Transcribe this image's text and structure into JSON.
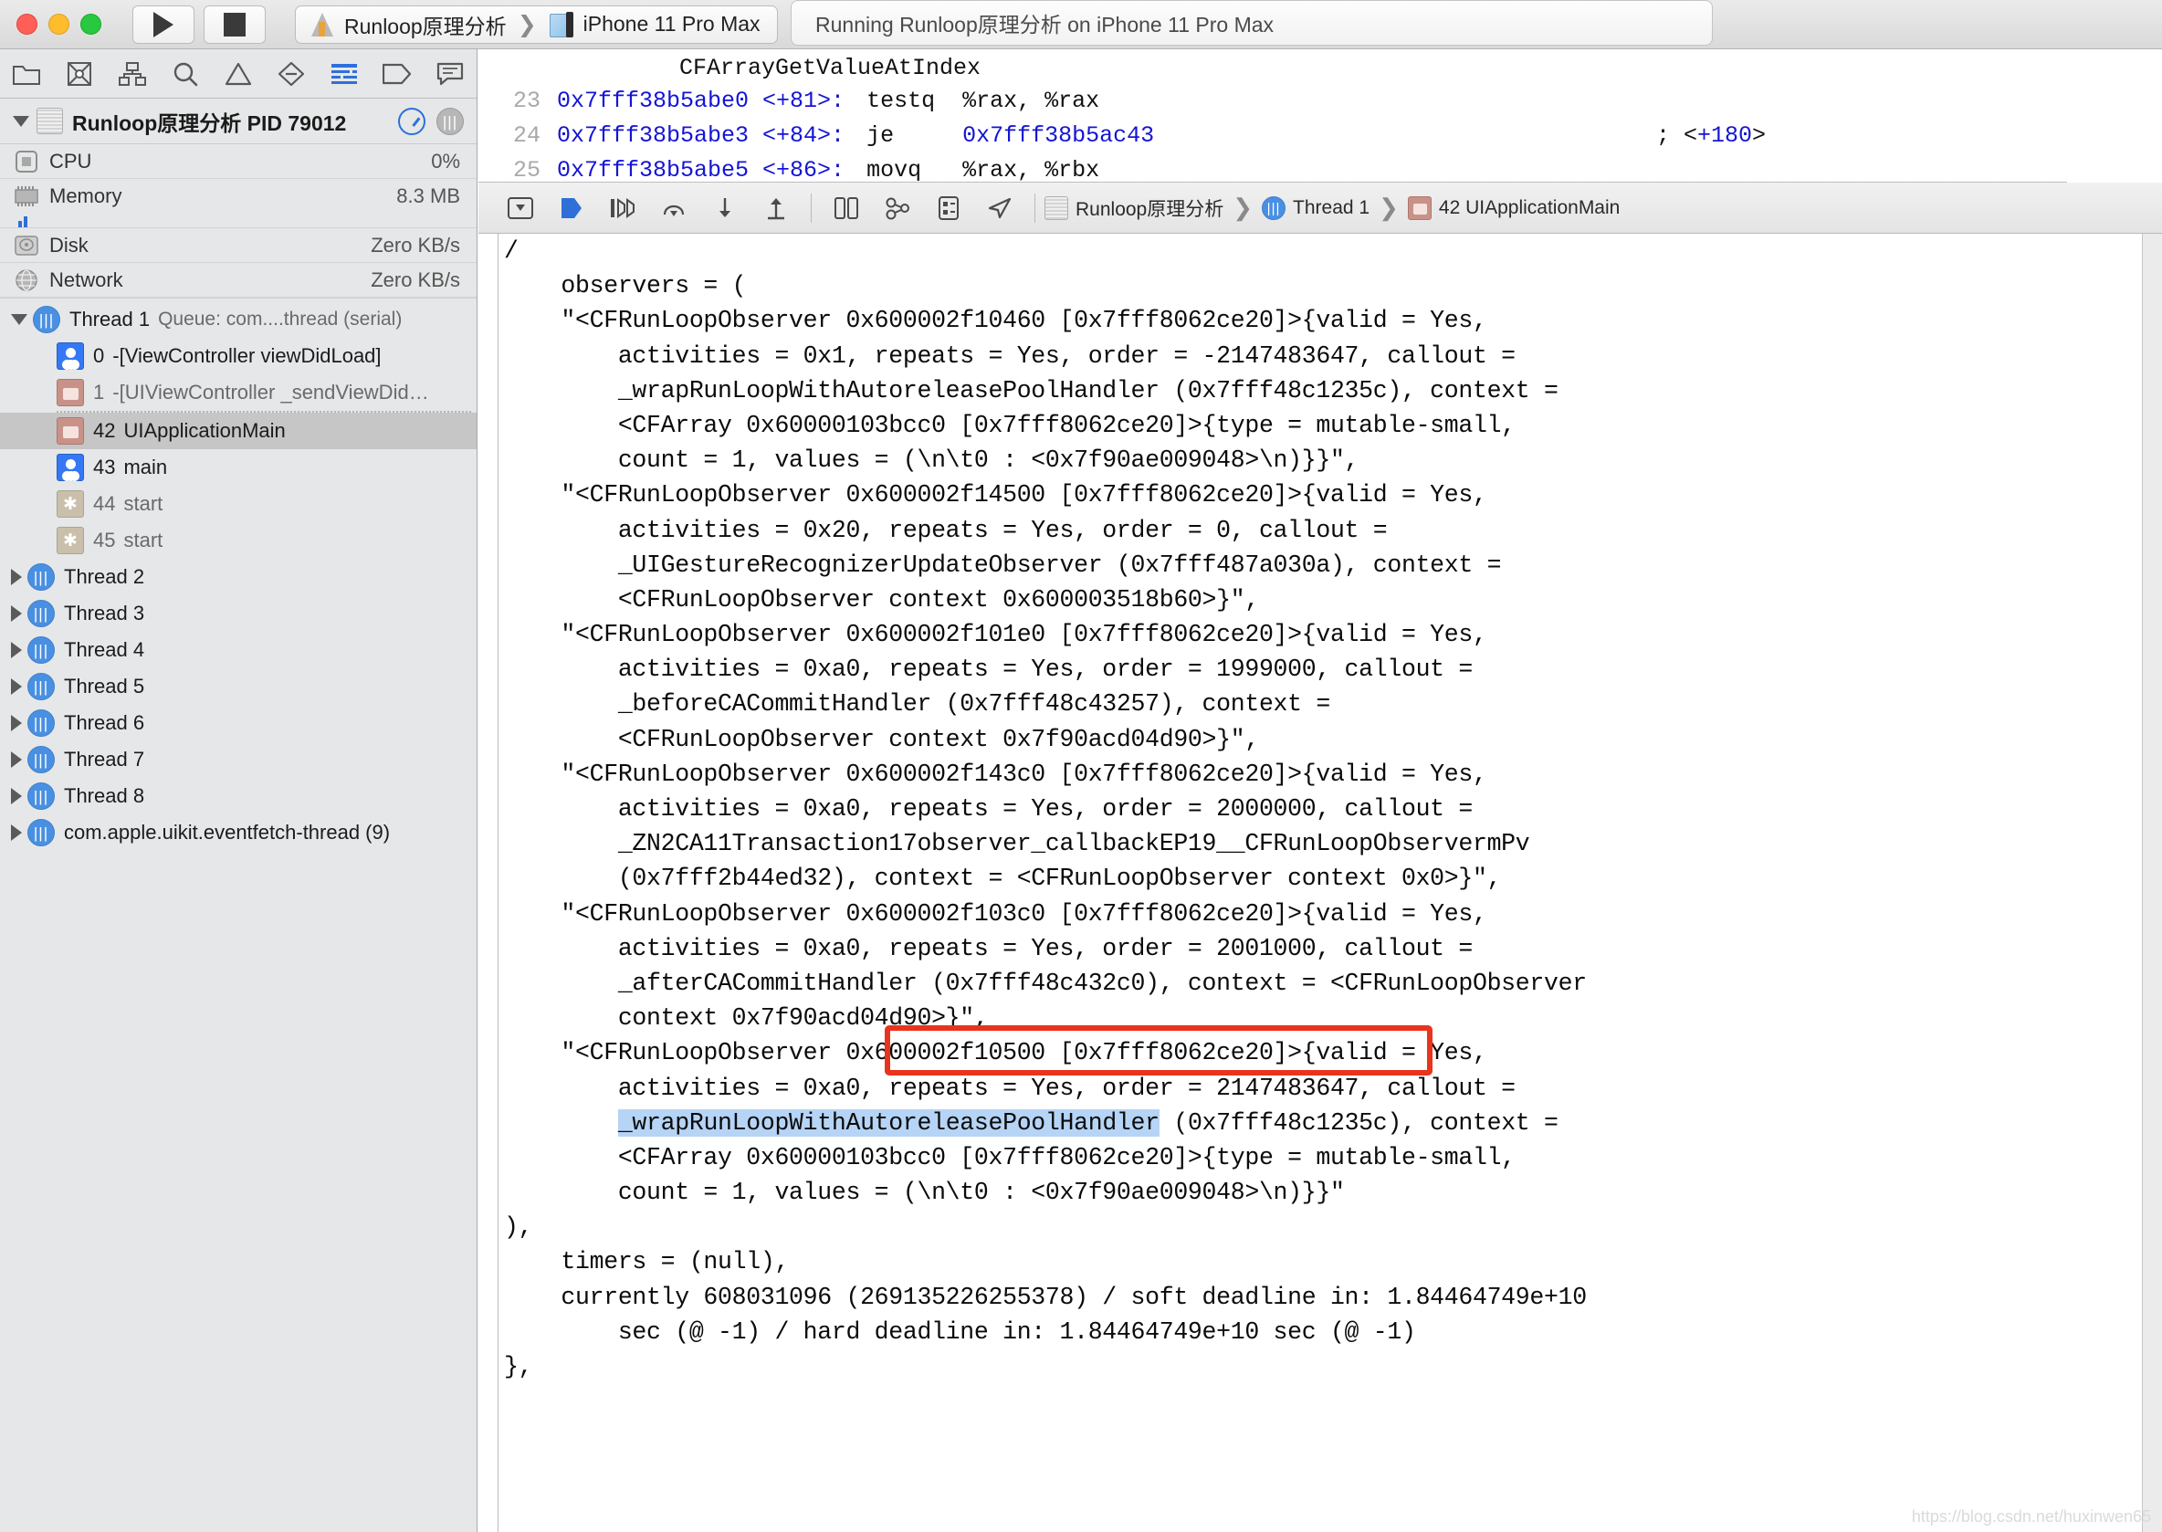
{
  "titlebar": {
    "run_button": "run-play",
    "stop_button": "stop",
    "scheme_name": "Runloop原理分析",
    "destination_name": "iPhone 11 Pro Max",
    "scheme_separator": "❯",
    "status_text": "Running Runloop原理分析 on iPhone 11 Pro Max"
  },
  "navigator": {
    "toolbar_icons": [
      "folder-icon",
      "source-control-icon",
      "symbol-icon",
      "search-icon",
      "warning-icon",
      "breakpoint-icon",
      "debug-report-icon",
      "tag-icon",
      "comment-icon"
    ],
    "header": {
      "title": "Runloop原理分析 PID 79012",
      "gauge_icon": "gauge-icon",
      "thread_icon": "threads-icon"
    },
    "gauges": [
      {
        "icon": "cpu-icon",
        "label": "CPU",
        "value": "0%"
      },
      {
        "icon": "memory-icon",
        "label": "Memory",
        "value": "8.3 MB"
      },
      {
        "icon": "disk-icon",
        "label": "Disk",
        "value": "Zero KB/s"
      },
      {
        "icon": "network-icon",
        "label": "Network",
        "value": "Zero KB/s"
      }
    ],
    "threads": [
      {
        "type": "thread",
        "expanded": true,
        "selected": false,
        "label": "Thread 1",
        "sublabel": "Queue: com....thread (serial)",
        "frames": [
          {
            "index": "0",
            "label": "-[ViewController viewDidLoad]",
            "icon": "user-frame-icon",
            "dim": false,
            "selected": false
          },
          {
            "index": "1",
            "label": "-[UIViewController _sendViewDid…",
            "icon": "system-frame-icon",
            "dim": true,
            "selected": false
          },
          {
            "index": "42",
            "label": "UIApplicationMain",
            "icon": "system-frame-icon",
            "dim": false,
            "selected": true
          },
          {
            "index": "43",
            "label": "main",
            "icon": "user-frame-icon",
            "dim": false,
            "selected": false
          },
          {
            "index": "44",
            "label": "start",
            "icon": "gear-frame-icon",
            "dim": true,
            "selected": false
          },
          {
            "index": "45",
            "label": "start",
            "icon": "gear-frame-icon",
            "dim": true,
            "selected": false
          }
        ]
      },
      {
        "type": "thread",
        "expanded": false,
        "selected": false,
        "label": "Thread 2",
        "sublabel": "",
        "frames": []
      },
      {
        "type": "thread",
        "expanded": false,
        "selected": false,
        "label": "Thread 3",
        "sublabel": "",
        "frames": []
      },
      {
        "type": "thread",
        "expanded": false,
        "selected": false,
        "label": "Thread 4",
        "sublabel": "",
        "frames": []
      },
      {
        "type": "thread",
        "expanded": false,
        "selected": false,
        "label": "Thread 5",
        "sublabel": "",
        "frames": []
      },
      {
        "type": "thread",
        "expanded": false,
        "selected": false,
        "label": "Thread 6",
        "sublabel": "",
        "frames": []
      },
      {
        "type": "thread",
        "expanded": false,
        "selected": false,
        "label": "Thread 7",
        "sublabel": "",
        "frames": []
      },
      {
        "type": "thread",
        "expanded": false,
        "selected": false,
        "label": "Thread 8",
        "sublabel": "",
        "frames": []
      },
      {
        "type": "thread",
        "expanded": false,
        "selected": false,
        "label": "com.apple.uikit.eventfetch-thread (9)",
        "sublabel": "",
        "frames": []
      }
    ]
  },
  "disassembly": {
    "symbol": "CFArrayGetValueAtIndex",
    "lines": [
      {
        "num": "23",
        "addr": "0x7fff38b5abe0 <+81>:",
        "op": "testq  %rax, %rax",
        "target": "",
        "comment": "",
        "comment_ref": ""
      },
      {
        "num": "24",
        "addr": "0x7fff38b5abe3 <+84>:",
        "op": "je     ",
        "target": "0x7fff38b5ac43",
        "comment": "; <",
        "comment_ref": "+180"
      },
      {
        "num": "25",
        "addr": "0x7fff38b5abe5 <+86>:",
        "op": "movq   %rax, %rbx",
        "target": "",
        "comment": "",
        "comment_ref": ""
      }
    ]
  },
  "debugbar": {
    "icons": [
      "hide-debug-area-icon",
      "continue-icon",
      "step-over-icon",
      "step-into-icon",
      "step-out-icon",
      "step-out-up-icon",
      "view-hierarchy-icon",
      "memory-graph-icon",
      "environment-overrides-icon",
      "location-simulate-icon"
    ],
    "breadcrumb": [
      {
        "icon": "app-icon",
        "label": "Runloop原理分析"
      },
      {
        "icon": "thread-icon",
        "label": "Thread 1"
      },
      {
        "icon": "frame-icon",
        "label": "42 UIApplicationMain"
      }
    ],
    "separator": "❯"
  },
  "console": {
    "selection_text": "_wrapRunLoopWithAutoreleasePoolHandler",
    "annotation_color": "#e8341c",
    "selection_color": "#b6d4f5",
    "lines": [
      "/",
      "    observers = (",
      "    \"<CFRunLoopObserver 0x600002f10460 [0x7fff8062ce20]>{valid = Yes,",
      "        activities = 0x1, repeats = Yes, order = -2147483647, callout =",
      "        _wrapRunLoopWithAutoreleasePoolHandler (0x7fff48c1235c), context =",
      "        <CFArray 0x60000103bcc0 [0x7fff8062ce20]>{type = mutable-small,",
      "        count = 1, values = (\\n\\t0 : <0x7f90ae009048>\\n)}}\",",
      "    \"<CFRunLoopObserver 0x600002f14500 [0x7fff8062ce20]>{valid = Yes,",
      "        activities = 0x20, repeats = Yes, order = 0, callout =",
      "        _UIGestureRecognizerUpdateObserver (0x7fff487a030a), context =",
      "        <CFRunLoopObserver context 0x600003518b60>}\",",
      "    \"<CFRunLoopObserver 0x600002f101e0 [0x7fff8062ce20]>{valid = Yes,",
      "        activities = 0xa0, repeats = Yes, order = 1999000, callout =",
      "        _beforeCACommitHandler (0x7fff48c43257), context =",
      "        <CFRunLoopObserver context 0x7f90acd04d90>}\",",
      "    \"<CFRunLoopObserver 0x600002f143c0 [0x7fff8062ce20]>{valid = Yes,",
      "        activities = 0xa0, repeats = Yes, order = 2000000, callout =",
      "        _ZN2CA11Transaction17observer_callbackEP19__CFRunLoopObservermPv",
      "        (0x7fff2b44ed32), context = <CFRunLoopObserver context 0x0>}\",",
      "    \"<CFRunLoopObserver 0x600002f103c0 [0x7fff8062ce20]>{valid = Yes,",
      "        activities = 0xa0, repeats = Yes, order = 2001000, callout =",
      "        _afterCACommitHandler (0x7fff48c432c0), context = <CFRunLoopObserver",
      "        context 0x7f90acd04d90>}\",",
      "    \"<CFRunLoopObserver 0x600002f10500 [0x7fff8062ce20]>{valid = Yes,",
      "        activities = 0xa0, repeats = Yes, order = 2147483647, callout =",
      "        _wrapRunLoopWithAutoreleasePoolHandler (0x7fff48c1235c), context =",
      "        <CFArray 0x60000103bcc0 [0x7fff8062ce20]>{type = mutable-small,",
      "        count = 1, values = (\\n\\t0 : <0x7f90ae009048>\\n)}}\"",
      "),",
      "    timers = (null),",
      "    currently 608031096 (269135226255378) / soft deadline in: 1.84464749e+10",
      "        sec (@ -1) / hard deadline in: 1.84464749e+10 sec (@ -1)",
      "},"
    ],
    "highlight_line_index": 25
  },
  "watermark": {
    "text": "https://blog.csdn.net/huxinwen65"
  }
}
